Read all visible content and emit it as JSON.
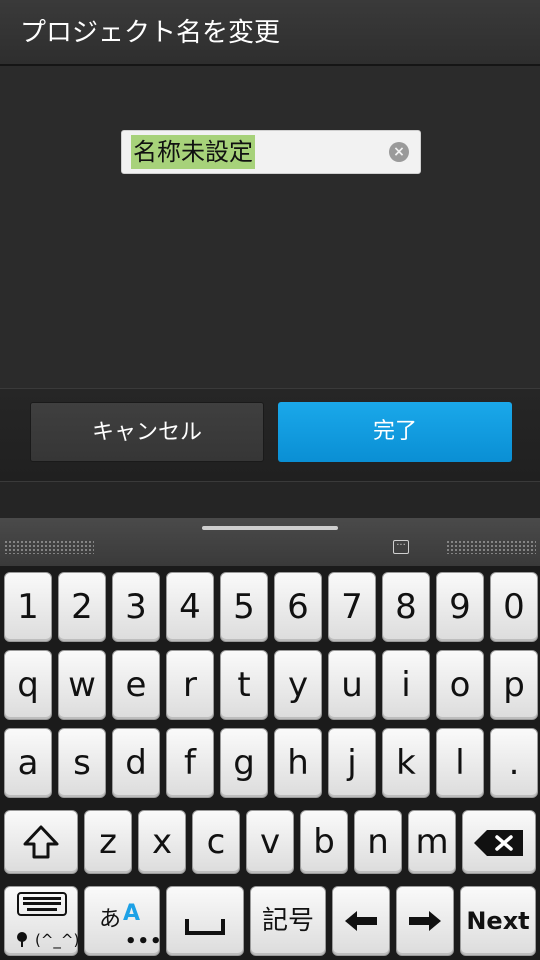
{
  "title_bar": {
    "title": "プロジェクト名を変更"
  },
  "dialog": {
    "name_input": {
      "value": "名称未設定"
    },
    "cancel_label": "キャンセル",
    "done_label": "完了"
  },
  "keyboard": {
    "row1": [
      "1",
      "2",
      "3",
      "4",
      "5",
      "6",
      "7",
      "8",
      "9",
      "0"
    ],
    "row2": [
      "q",
      "w",
      "e",
      "r",
      "t",
      "y",
      "u",
      "i",
      "o",
      "p"
    ],
    "row3": [
      "a",
      "s",
      "d",
      "f",
      "g",
      "h",
      "j",
      "k",
      "l",
      "."
    ],
    "row4": [
      "z",
      "x",
      "c",
      "v",
      "b",
      "n",
      "m"
    ],
    "bottom": {
      "emoticon_label": "(^_^)",
      "mode_label_hira": "あ",
      "mode_label_alpha": "A",
      "symbols_label": "記号",
      "next_label": "Next"
    },
    "colors": {
      "accent": "#0a8fd4",
      "selection": "#a7d27a"
    }
  }
}
